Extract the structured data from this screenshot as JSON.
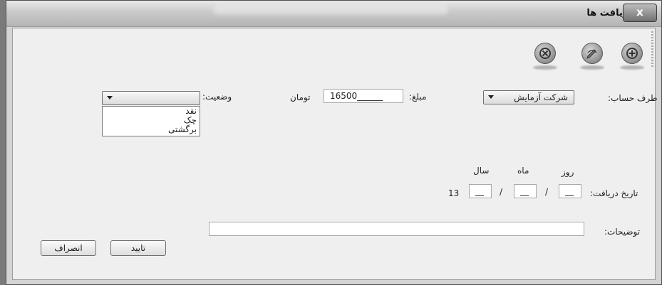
{
  "window": {
    "title": "دریافت ها",
    "close_label": "x"
  },
  "toolbar": {
    "items": [
      "delete-icon",
      "edit-icon",
      "add-icon"
    ]
  },
  "form": {
    "account_label": "طرف حساب:",
    "account_value": "شرکت آزمایش",
    "amount_label": "مبلغ:",
    "amount_value": "16500______",
    "currency_label": "تومان",
    "status_label": "وضعیت:",
    "status_value": "",
    "status_options": [
      "نقد",
      "چک",
      "برگشتی"
    ],
    "date_label": "تاریخ دریافت:",
    "day_label": "روز",
    "month_label": "ماه",
    "year_label": "سال",
    "day_value": "__",
    "month_value": "__",
    "year_value": "__",
    "date_sep": "/",
    "year_prefix": "13",
    "notes_label": "توضیحات:",
    "notes_value": ""
  },
  "buttons": {
    "confirm": "تایید",
    "cancel": "انصراف"
  }
}
